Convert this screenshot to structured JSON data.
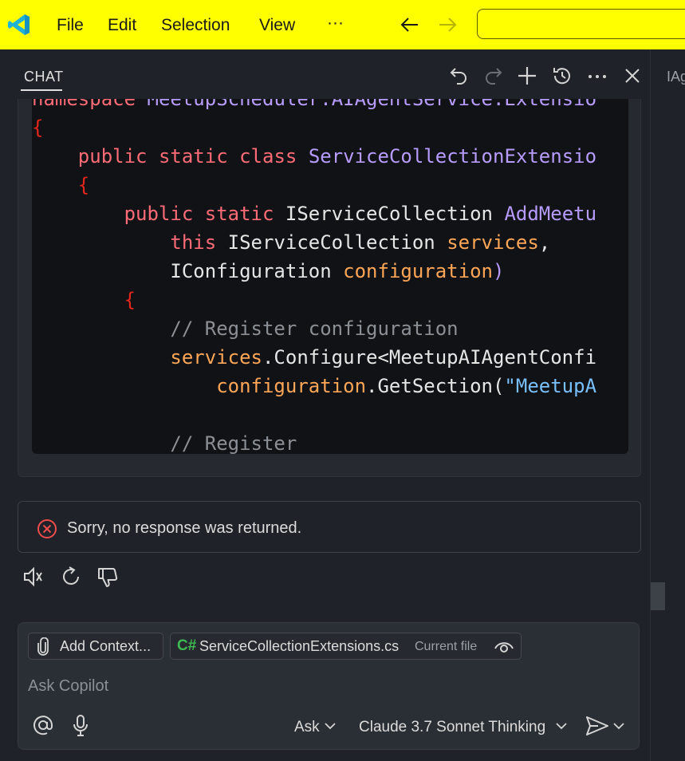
{
  "menu": {
    "file": "File",
    "edit": "Edit",
    "selection": "Selection",
    "view": "View",
    "more": "···"
  },
  "chat": {
    "tab_label": "CHAT",
    "side_label": "IAg"
  },
  "code_lines": [
    [
      {
        "t": "namespace ",
        "c": "kw"
      },
      {
        "t": "MeetupScheduler.AIAgentService.Extensio",
        "c": "type"
      }
    ],
    [
      {
        "t": "{",
        "c": "brace"
      }
    ],
    [
      {
        "t": "    ",
        "c": "id"
      },
      {
        "t": "public ",
        "c": "kw"
      },
      {
        "t": "static ",
        "c": "kw"
      },
      {
        "t": "class ",
        "c": "kw"
      },
      {
        "t": "ServiceCollectionExtensio",
        "c": "type"
      }
    ],
    [
      {
        "t": "    ",
        "c": "id"
      },
      {
        "t": "{",
        "c": "brace"
      }
    ],
    [
      {
        "t": "        ",
        "c": "id"
      },
      {
        "t": "public ",
        "c": "kw"
      },
      {
        "t": "static ",
        "c": "kw"
      },
      {
        "t": "IServiceCollection ",
        "c": "id"
      },
      {
        "t": "AddMeetu",
        "c": "type"
      }
    ],
    [
      {
        "t": "            ",
        "c": "id"
      },
      {
        "t": "this ",
        "c": "kw"
      },
      {
        "t": "IServiceCollection ",
        "c": "id"
      },
      {
        "t": "services",
        "c": "ident"
      },
      {
        "t": ",",
        "c": "punct"
      }
    ],
    [
      {
        "t": "            ",
        "c": "id"
      },
      {
        "t": "IConfiguration ",
        "c": "id"
      },
      {
        "t": "configuration",
        "c": "ident"
      },
      {
        "t": ")",
        "c": "type"
      }
    ],
    [
      {
        "t": "        ",
        "c": "id"
      },
      {
        "t": "{",
        "c": "brace"
      }
    ],
    [
      {
        "t": "            ",
        "c": "id"
      },
      {
        "t": "// Register configuration",
        "c": "comment"
      }
    ],
    [
      {
        "t": "            ",
        "c": "id"
      },
      {
        "t": "services",
        "c": "ident"
      },
      {
        "t": ".Configure<MeetupAIAgentConfi",
        "c": "id"
      }
    ],
    [
      {
        "t": "                ",
        "c": "id"
      },
      {
        "t": "configuration",
        "c": "ident"
      },
      {
        "t": ".GetSection(",
        "c": "id"
      },
      {
        "t": "\"MeetupA",
        "c": "str"
      }
    ],
    [
      {
        "t": "",
        "c": "id"
      }
    ],
    [
      {
        "t": "            ",
        "c": "id"
      },
      {
        "t": "// Register",
        "c": "comment"
      }
    ]
  ],
  "error": {
    "message": "Sorry, no response was returned."
  },
  "input": {
    "add_context": "Add Context...",
    "file_badge": "C#",
    "file_name": "ServiceCollectionExtensions.cs",
    "file_sub": "Current file",
    "placeholder": "Ask Copilot",
    "mode": "Ask",
    "model": "Claude 3.7 Sonnet Thinking"
  },
  "colors": {
    "titlebar": "#ffff00",
    "editor_bg": "#1f2228",
    "code_bg": "#111215",
    "error_red": "#f14c4c",
    "csharp_green": "#3fb950"
  },
  "icons": {
    "logo": "vscode-logo-icon",
    "back": "arrow-left-icon",
    "forward": "arrow-right-icon",
    "undo": "undo-icon",
    "redo": "redo-icon",
    "new_chat": "plus-icon",
    "history": "history-icon",
    "more": "ellipsis-icon",
    "close": "close-icon",
    "error": "error-circle-icon",
    "speaker": "speaker-icon",
    "retry": "refresh-icon",
    "thumbs_down": "thumbs-down-icon",
    "attach": "paperclip-icon",
    "eye": "eye-icon",
    "mention": "at-icon",
    "mic": "mic-icon",
    "send": "send-icon"
  }
}
